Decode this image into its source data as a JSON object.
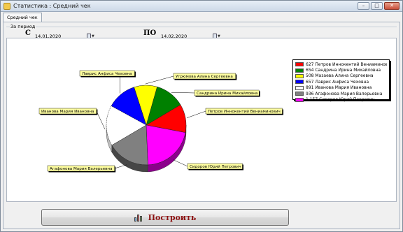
{
  "window": {
    "title": "Статистика : Средний чек",
    "buttons": [
      "–",
      "□",
      "✕"
    ]
  },
  "tabs": [
    {
      "label": "Средний чек"
    }
  ],
  "filters": {
    "group_label": "За период",
    "from_label": "С",
    "from_value": "14.01.2020",
    "to_label": "ПО",
    "to_value": "14.02.2020"
  },
  "colors": {
    "red": "#ff0000",
    "green": "#008000",
    "yellow": "#ffff00",
    "blue": "#0000ff",
    "white": "#ffffff",
    "gray": "#808080",
    "magenta": "#ff00ff",
    "label_bg": "#ffffa0"
  },
  "chart_data": {
    "type": "pie",
    "title": "",
    "legend_position": "top-right",
    "slices": [
      {
        "legend": "627 Петров Иннокентий Вениаминович",
        "label": "Петров Иннокентий Вениаминович",
        "value": 627,
        "color": "#ff0000"
      },
      {
        "legend": "654 Сандрина Ирина Михайловна",
        "label": "Сандрина Ирина Михайловна",
        "value": 654,
        "color": "#008000"
      },
      {
        "legend": "508 Мазаева Алина Сергеевна",
        "label": "Угрюмова Алина Сергеевна",
        "value": 508,
        "color": "#ffff00"
      },
      {
        "legend": "657 Лаврис Анфиса Чеховна",
        "label": "Лаврис Анфиса Чеховна",
        "value": 657,
        "color": "#0000ff"
      },
      {
        "legend": "891 Иванова Мария Ивановна",
        "label": "Иванова Мария Ивановна",
        "value": 891,
        "color": "#ffffff"
      },
      {
        "legend": "936 Агафонова Мария Валерьевна",
        "label": "Агафонова Мария Валерьевна",
        "value": 936,
        "color": "#808080"
      },
      {
        "legend": "1 157 Сидоров Юрий Петрович",
        "label": "Сидоров Юрий Петрович",
        "value": 1157,
        "color": "#ff00ff"
      }
    ]
  },
  "actions": {
    "build_label": "Построить"
  }
}
